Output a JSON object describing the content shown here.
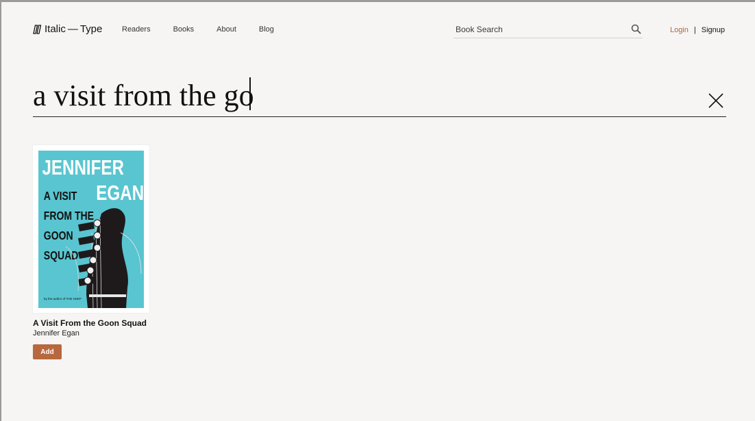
{
  "brand": {
    "name": "Italic — Type"
  },
  "nav": {
    "items": [
      {
        "label": "Readers"
      },
      {
        "label": "Books"
      },
      {
        "label": "About"
      },
      {
        "label": "Blog"
      }
    ]
  },
  "header_search": {
    "placeholder": "Book Search",
    "icon": "search-icon"
  },
  "auth": {
    "login": "Login",
    "separator": "|",
    "signup": "Signup"
  },
  "query": {
    "value": "a visit from the go",
    "clear_icon": "close-icon"
  },
  "results": [
    {
      "title": "A Visit From the Goon Squad",
      "author": "Jennifer Egan",
      "add_label": "Add",
      "cover": {
        "author_line1": "JENNIFER",
        "author_line2": "EGAN",
        "title_lines": [
          "A VISIT",
          "FROM THE",
          "GOON",
          "SQUAD"
        ],
        "footer": "by the author of THE KEEP",
        "bg_color": "#59c5d0"
      }
    }
  ],
  "colors": {
    "accent": "#b8683f",
    "login": "#b5643c",
    "background": "#f6f5f3"
  }
}
